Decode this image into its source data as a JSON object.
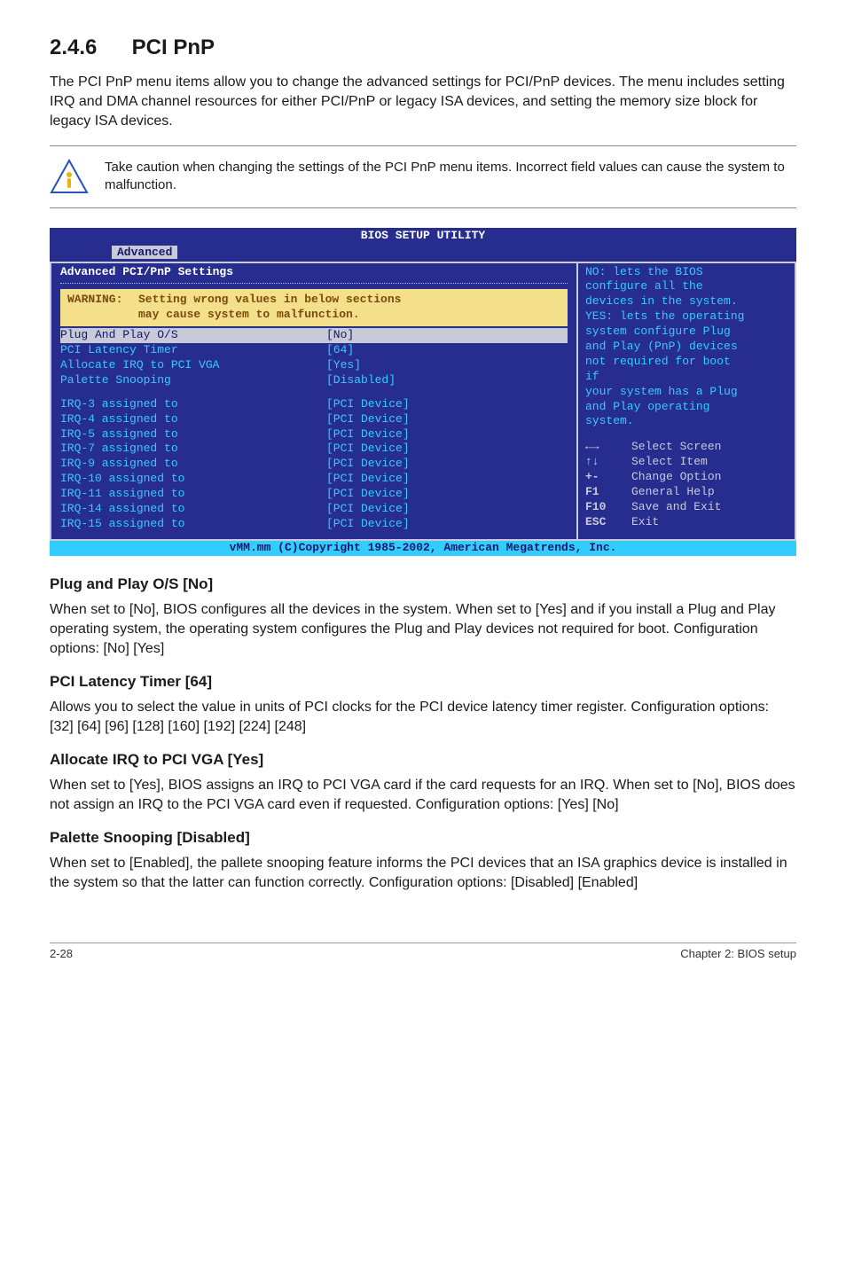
{
  "section": {
    "number": "2.4.6",
    "title": "PCI PnP"
  },
  "intro": "The PCI PnP menu items allow you to change the advanced settings for PCI/PnP devices. The menu includes setting IRQ and DMA channel resources for either PCI/PnP or legacy ISA devices, and setting the memory size block for legacy ISA devices.",
  "callout": "Take caution when changing the settings of the PCI PnP menu items. Incorrect field values can cause the system to malfunction.",
  "bios": {
    "title_left": " Advanced ",
    "title_main": "BIOS SETUP UTILITY",
    "panel_heading": "Advanced PCI/PnP Settings",
    "warn_label": "WARNING:",
    "warn_line1": "Setting wrong values in below sections",
    "warn_line2": "may cause system to malfunction.",
    "rows_a": [
      {
        "label": "Plug And Play O/S",
        "val": "[No]"
      },
      {
        "label": "PCI Latency Timer",
        "val": "[64]"
      },
      {
        "label": "Allocate IRQ to PCI VGA",
        "val": "[Yes]"
      },
      {
        "label": "Palette Snooping",
        "val": "[Disabled]"
      }
    ],
    "rows_b": [
      {
        "label": "IRQ-3 assigned to",
        "val": "[PCI Device]"
      },
      {
        "label": "IRQ-4 assigned to",
        "val": "[PCI Device]"
      },
      {
        "label": "IRQ-5 assigned to",
        "val": "[PCI Device]"
      },
      {
        "label": "IRQ-7 assigned to",
        "val": "[PCI Device]"
      },
      {
        "label": "IRQ-9 assigned to",
        "val": "[PCI Device]"
      },
      {
        "label": "IRQ-10 assigned to",
        "val": "[PCI Device]"
      },
      {
        "label": "IRQ-11 assigned to",
        "val": "[PCI Device]"
      },
      {
        "label": "IRQ-14 assigned to",
        "val": "[PCI Device]"
      },
      {
        "label": "IRQ-15 assigned to",
        "val": "[PCI Device]"
      }
    ],
    "right_text_lines": [
      "NO: lets the BIOS",
      "configure  all the",
      "devices in the system.",
      "YES: lets the operating",
      "system configure Plug",
      "and Play (PnP) devices",
      "not required for boot",
      "if",
      "your system has a Plug",
      "and Play operating",
      "system."
    ],
    "help": [
      {
        "key": "←→",
        "label": "Select Screen"
      },
      {
        "key": "↑↓",
        "label": "Select Item"
      },
      {
        "key": "+-",
        "label": "Change Option"
      },
      {
        "key": "F1",
        "label": "General Help"
      },
      {
        "key": "F10",
        "label": "Save and Exit"
      },
      {
        "key": "ESC",
        "label": "Exit"
      }
    ],
    "footer": "vMM.mm (C)Copyright 1985-2002, American Megatrends, Inc."
  },
  "subs": [
    {
      "h": "Plug and Play O/S [No]",
      "p": "When set to [No], BIOS configures all the devices in the system. When set to [Yes] and if you install a Plug and Play operating system, the operating system configures the Plug and Play devices not required for boot. Configuration options: [No] [Yes]"
    },
    {
      "h": "PCI Latency Timer [64]",
      "p": "Allows you to select the value in units of PCI clocks for the PCI device latency timer register. Configuration options: [32] [64] [96] [128] [160] [192] [224] [248]"
    },
    {
      "h": "Allocate IRQ to PCI VGA [Yes]",
      "p": "When set to [Yes], BIOS assigns an IRQ to PCI VGA card if the card requests for an IRQ. When set to [No], BIOS does not assign an IRQ to the PCI VGA card even if requested. Configuration options: [Yes] [No]"
    },
    {
      "h": "Palette Snooping [Disabled]",
      "p": "When set to [Enabled], the pallete snooping feature informs the PCI devices that an ISA graphics device is installed in the system so that the latter can function correctly. Configuration options: [Disabled] [Enabled]"
    }
  ],
  "footer": {
    "left": "2-28",
    "right": "Chapter 2: BIOS setup"
  }
}
